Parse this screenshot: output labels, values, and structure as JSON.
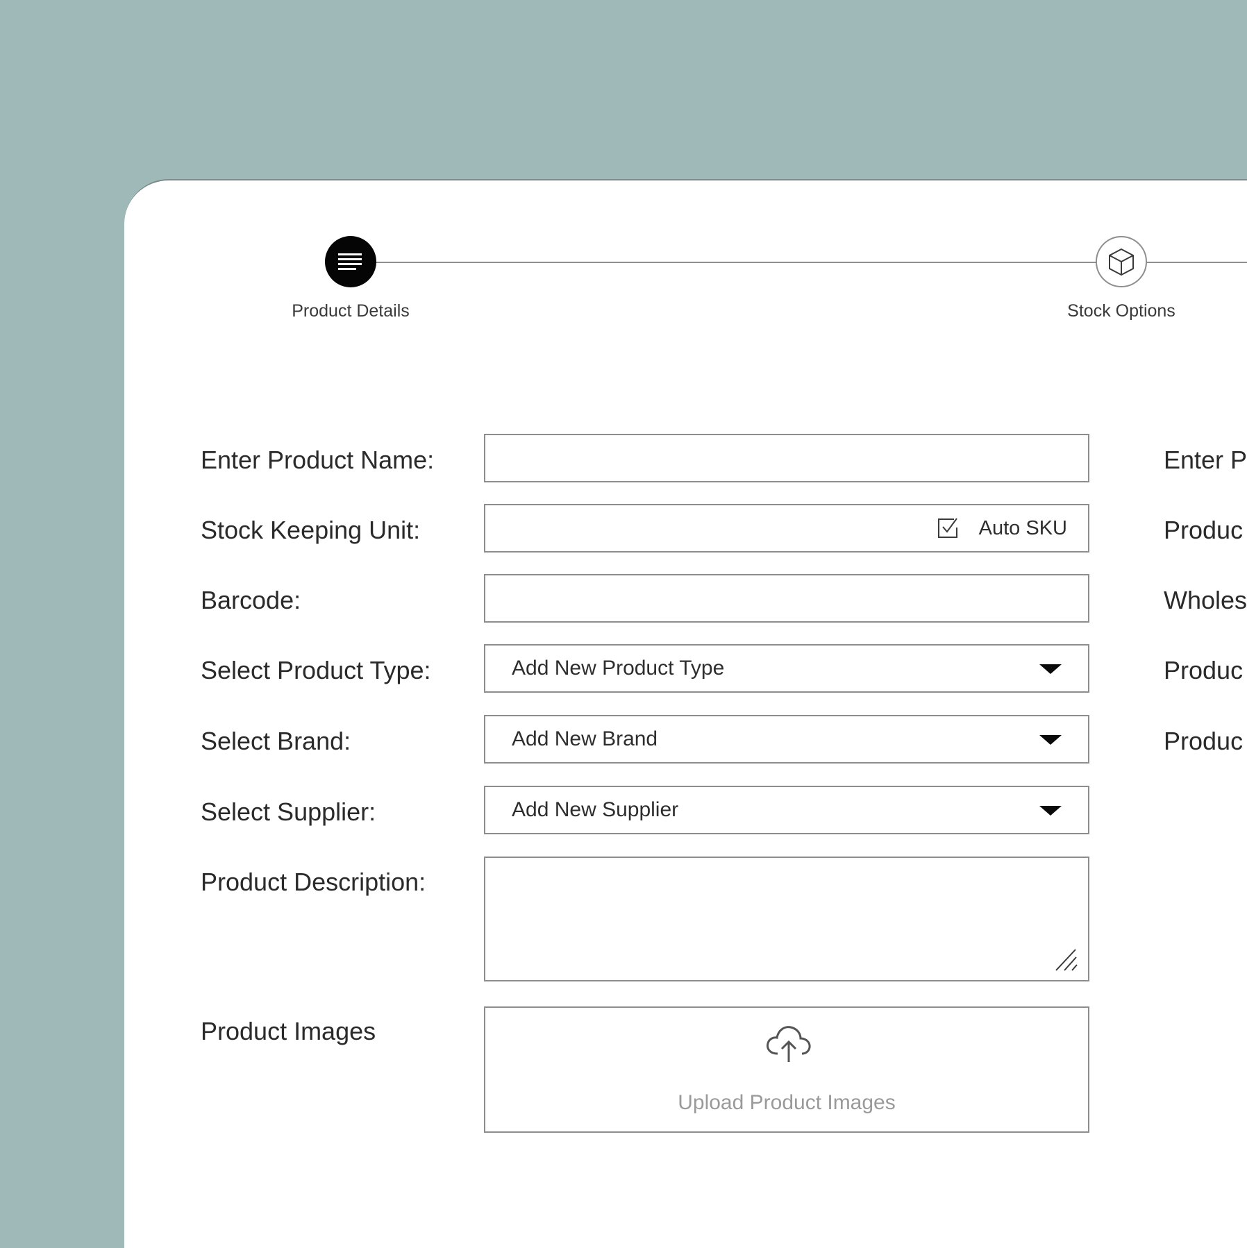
{
  "stepper": {
    "steps": [
      {
        "label": "Product Details",
        "icon": "details-lines-icon",
        "active": true
      },
      {
        "label": "Stock Options",
        "icon": "box-icon",
        "active": false
      }
    ]
  },
  "form": {
    "product_name": {
      "label": "Enter Product Name:",
      "value": ""
    },
    "sku": {
      "label": "Stock Keeping Unit:",
      "value": "",
      "auto_label": "Auto SKU"
    },
    "barcode": {
      "label": "Barcode:",
      "value": ""
    },
    "product_type": {
      "label": "Select Product Type:",
      "selected": "Add New Product Type"
    },
    "brand": {
      "label": "Select Brand:",
      "selected": "Add New Brand"
    },
    "supplier": {
      "label": "Select Supplier:",
      "selected": "Add New Supplier"
    },
    "description": {
      "label": "Product Description:",
      "value": ""
    },
    "images": {
      "label": "Product Images",
      "upload_text": "Upload Product Images"
    }
  },
  "right_column": {
    "labels": [
      "Enter P",
      "Produc",
      "Wholes",
      "Produc",
      "Produc"
    ]
  },
  "colors": {
    "background": "#9fb8b8",
    "card": "#ffffff",
    "active_step": "#050505",
    "border": "#8d8d8d"
  }
}
